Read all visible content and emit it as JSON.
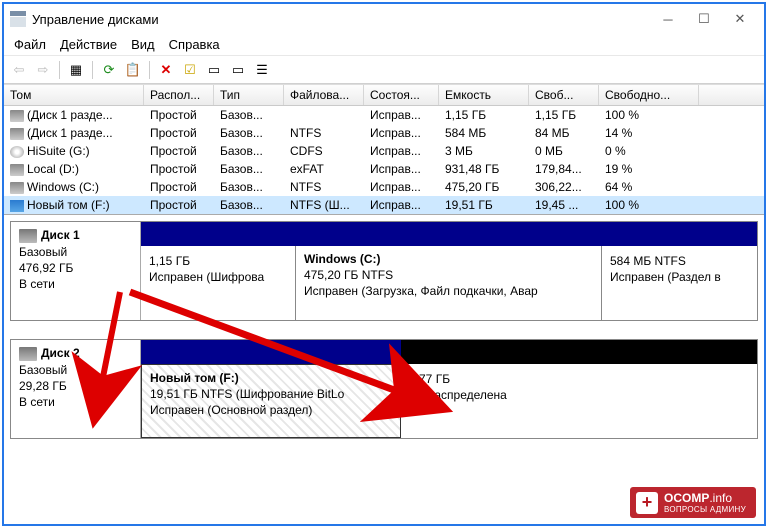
{
  "window": {
    "title": "Управление дисками"
  },
  "menu": {
    "file": "Файл",
    "action": "Действие",
    "view": "Вид",
    "help": "Справка"
  },
  "columns": {
    "volume": "Том",
    "layout": "Распол...",
    "type": "Тип",
    "fs": "Файлова...",
    "status": "Состоя...",
    "capacity": "Емкость",
    "free": "Своб...",
    "freepct": "Свободно..."
  },
  "volumes": [
    {
      "icon": "hdd",
      "name": "(Диск 1 разде...",
      "layout": "Простой",
      "type": "Базов...",
      "fs": "",
      "status": "Исправ...",
      "capacity": "1,15 ГБ",
      "free": "1,15 ГБ",
      "freepct": "100 %"
    },
    {
      "icon": "hdd",
      "name": "(Диск 1 разде...",
      "layout": "Простой",
      "type": "Базов...",
      "fs": "NTFS",
      "status": "Исправ...",
      "capacity": "584 МБ",
      "free": "84 МБ",
      "freepct": "14 %"
    },
    {
      "icon": "cd",
      "name": "HiSuite (G:)",
      "layout": "Простой",
      "type": "Базов...",
      "fs": "CDFS",
      "status": "Исправ...",
      "capacity": "3 МБ",
      "free": "0 МБ",
      "freepct": "0 %"
    },
    {
      "icon": "hdd",
      "name": "Local (D:)",
      "layout": "Простой",
      "type": "Базов...",
      "fs": "exFAT",
      "status": "Исправ...",
      "capacity": "931,48 ГБ",
      "free": "179,84...",
      "freepct": "19 %"
    },
    {
      "icon": "hdd",
      "name": "Windows (C:)",
      "layout": "Простой",
      "type": "Базов...",
      "fs": "NTFS",
      "status": "Исправ...",
      "capacity": "475,20 ГБ",
      "free": "306,22...",
      "freepct": "64 %"
    },
    {
      "icon": "sel",
      "name": "Новый том (F:)",
      "layout": "Простой",
      "type": "Базов...",
      "fs": "NTFS (Ш...",
      "status": "Исправ...",
      "capacity": "19,51 ГБ",
      "free": "19,45 ...",
      "freepct": "100 %"
    }
  ],
  "disks": {
    "d1": {
      "name": "Диск 1",
      "type": "Базовый",
      "size": "476,92 ГБ",
      "status": "В сети",
      "parts": [
        {
          "name": "",
          "line2": "1,15 ГБ",
          "line3": "Исправен (Шифрова"
        },
        {
          "name": "Windows  (C:)",
          "line2": "475,20 ГБ NTFS",
          "line3": "Исправен (Загрузка, Файл подкачки, Авар"
        },
        {
          "name": "",
          "line2": "584 МБ NTFS",
          "line3": "Исправен (Раздел в"
        }
      ]
    },
    "d2": {
      "name": "Диск 2",
      "type": "Базовый",
      "size": "29,28 ГБ",
      "status": "В сети",
      "parts": [
        {
          "name": "Новый том  (F:)",
          "line2": "19,51 ГБ NTFS (Шифрование BitLo",
          "line3": "Исправен (Основной раздел)"
        },
        {
          "name": "",
          "line2": "9,77 ГБ",
          "line3": "Не распределена"
        }
      ]
    }
  },
  "watermark": {
    "brand": "OCOMP",
    "tld": ".info",
    "sub": "ВОПРОСЫ АДМИНУ"
  }
}
